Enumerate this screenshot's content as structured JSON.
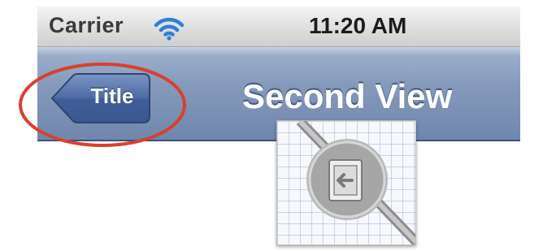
{
  "status_bar": {
    "carrier": "Carrier",
    "time": "11:20 AM",
    "wifi_icon": "wifi-icon"
  },
  "nav_bar": {
    "back_button_label": "Title",
    "title": "Second View"
  },
  "annotation": {
    "highlight_color": "#d9402b"
  },
  "segue": {
    "icon": "segue-icon"
  }
}
